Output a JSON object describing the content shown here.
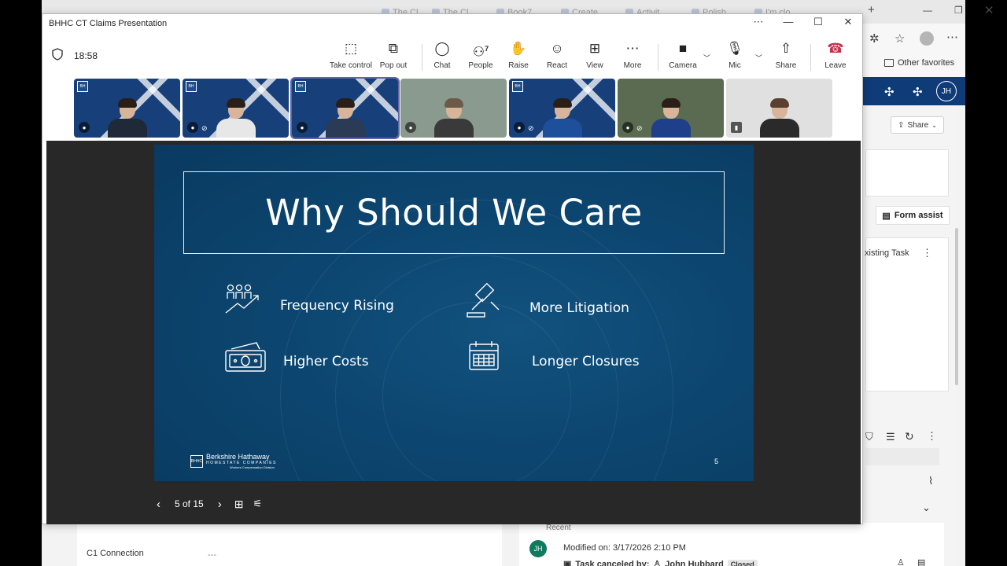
{
  "browser": {
    "tabs": [
      "The Cl",
      "The Cl",
      "Book7",
      "Create",
      "Activit",
      "Polish",
      "I'm clo"
    ],
    "favorites_label": "Other favorites",
    "avatar_initials": "JH",
    "share_label": "Share",
    "form_assist_label": "Form assist",
    "existing_task_label": "xisting Task",
    "c1_connection_label": "C1 Connection",
    "c1_connection_value": "---",
    "recent_label": "Recent",
    "modified_text": "Modified on: 3/17/2026 2:10 PM",
    "task_canceled_text": "Task canceled by:",
    "task_canceled_user": "John Hubbard",
    "task_status": "Closed",
    "modified_avatar": "JH"
  },
  "teams": {
    "window_title": "BHHC CT Claims Presentation",
    "time": "18:58",
    "toolbar": {
      "take_control": "Take control",
      "pop_out": "Pop out",
      "chat": "Chat",
      "people": "People",
      "people_count": "7",
      "raise": "Raise",
      "react": "React",
      "view": "View",
      "more": "More",
      "camera": "Camera",
      "mic": "Mic",
      "share": "Share",
      "leave": "Leave"
    },
    "colors": {
      "leave": "#c4314b",
      "selected_tile": "#6264a7",
      "slide_bg": "#0c4670"
    }
  },
  "slide": {
    "title": "Why Should We Care",
    "items": [
      {
        "label": "Frequency Rising",
        "icon": "people-trend-icon"
      },
      {
        "label": "More Litigation",
        "icon": "gavel-icon"
      },
      {
        "label": "Higher Costs",
        "icon": "money-icon"
      },
      {
        "label": "Longer Closures",
        "icon": "calendar-icon"
      }
    ],
    "logo_name": "Berkshire Hathaway",
    "logo_sub": "HOMESTATE COMPANIES",
    "logo_tagline": "Workers Compensation Division",
    "page_number": "5"
  },
  "slide_nav": {
    "position": "5 of 15"
  }
}
